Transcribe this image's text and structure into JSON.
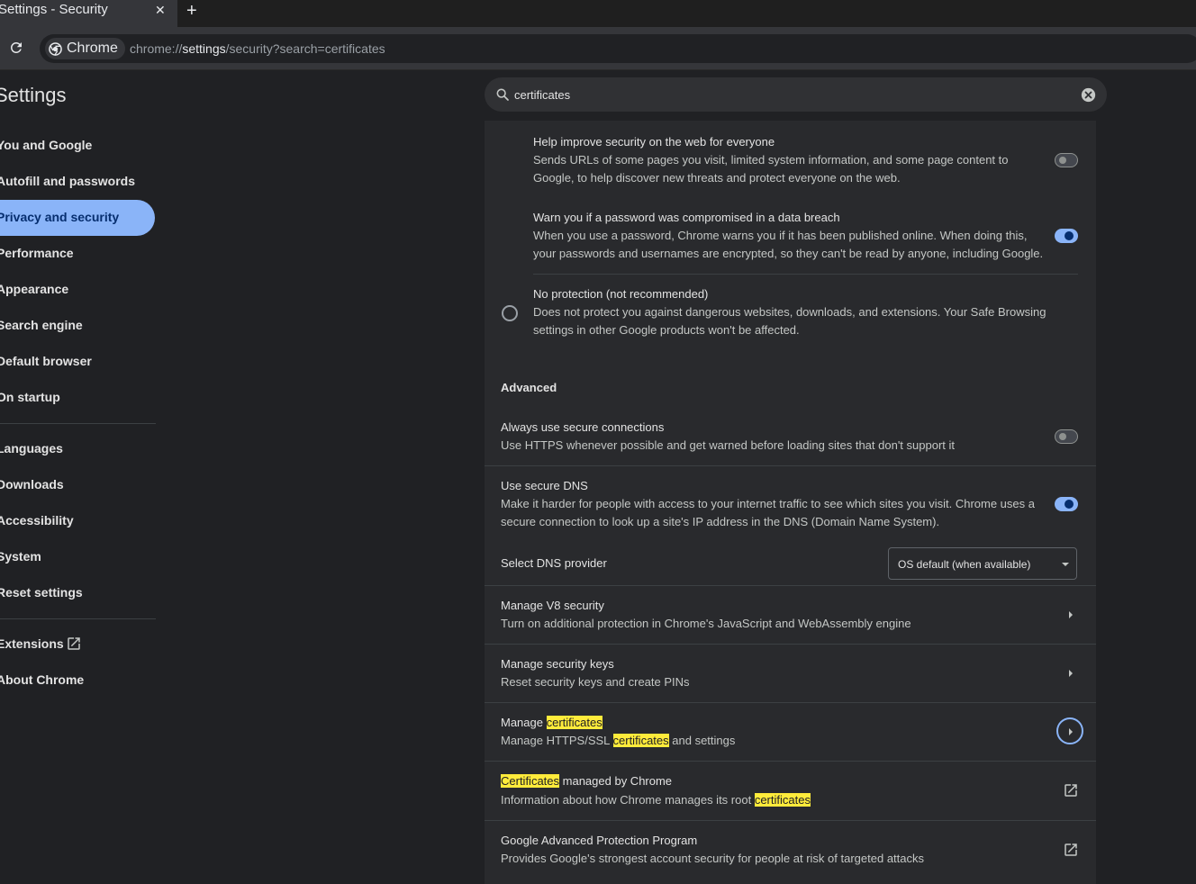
{
  "browser": {
    "tab_title": "Settings - Security",
    "tab_close": "✕",
    "new_tab": "+",
    "chip_label": "Chrome",
    "url_scheme": "chrome://",
    "url_host": "settings",
    "url_path": "/security?search=certificates"
  },
  "header": {
    "title": "Settings",
    "search_value": "certificates"
  },
  "sidebar": {
    "items": [
      {
        "label": "You and Google"
      },
      {
        "label": "Autofill and passwords"
      },
      {
        "label": "Privacy and security"
      },
      {
        "label": "Performance"
      },
      {
        "label": "Appearance"
      },
      {
        "label": "Search engine"
      },
      {
        "label": "Default browser"
      },
      {
        "label": "On startup"
      },
      {
        "label": "Languages"
      },
      {
        "label": "Downloads"
      },
      {
        "label": "Accessibility"
      },
      {
        "label": "System"
      },
      {
        "label": "Reset settings"
      },
      {
        "label": "Extensions"
      },
      {
        "label": "About Chrome"
      }
    ],
    "active_item": "Privacy and security"
  },
  "main": {
    "help_improve": {
      "title": "Help improve security on the web for everyone",
      "desc": "Sends URLs of some pages you visit, limited system information, and some page content to Google, to help discover new threats and protect everyone on the web.",
      "enabled": false
    },
    "password_breach": {
      "title": "Warn you if a password was compromised in a data breach",
      "desc": "When you use a password, Chrome warns you if it has been published online. When doing this, your passwords and usernames are encrypted, so they can't be read by anyone, including Google.",
      "enabled": true
    },
    "no_protection": {
      "title": "No protection (not recommended)",
      "desc": "Does not protect you against dangerous websites, downloads, and extensions. Your Safe Browsing settings in other Google products won't be affected.",
      "selected": false
    },
    "advanced_heading": "Advanced",
    "secure_connections": {
      "title": "Always use secure connections",
      "desc": "Use HTTPS whenever possible and get warned before loading sites that don't support it",
      "enabled": false
    },
    "secure_dns": {
      "title": "Use secure DNS",
      "desc": "Make it harder for people with access to your internet traffic to see which sites you visit. Chrome uses a secure connection to look up a site's IP address in the DNS (Domain Name System).",
      "enabled": true
    },
    "dns_provider": {
      "label": "Select DNS provider",
      "value": "OS default (when available)"
    },
    "v8_security": {
      "title": "Manage V8 security",
      "desc": "Turn on additional protection in Chrome's JavaScript and WebAssembly engine"
    },
    "security_keys": {
      "title": "Manage security keys",
      "desc": "Reset security keys and create PINs"
    },
    "manage_certs": {
      "title_prefix": "Manage ",
      "title_highlight": "certificates",
      "desc_prefix": "Manage HTTPS/SSL ",
      "desc_highlight": "certificates",
      "desc_suffix": " and settings"
    },
    "certs_managed": {
      "title_highlight": "Certificates",
      "title_suffix": " managed by Chrome",
      "desc_prefix": "Information about how Chrome manages its root ",
      "desc_highlight": "certificates"
    },
    "advanced_protection": {
      "title": "Google Advanced Protection Program",
      "desc": "Provides Google's strongest account security for people at risk of targeted attacks"
    }
  },
  "colors": {
    "accent": "#8ab4f8",
    "highlight": "#ffeb3b",
    "background": "#202124",
    "card": "#292a2d"
  }
}
